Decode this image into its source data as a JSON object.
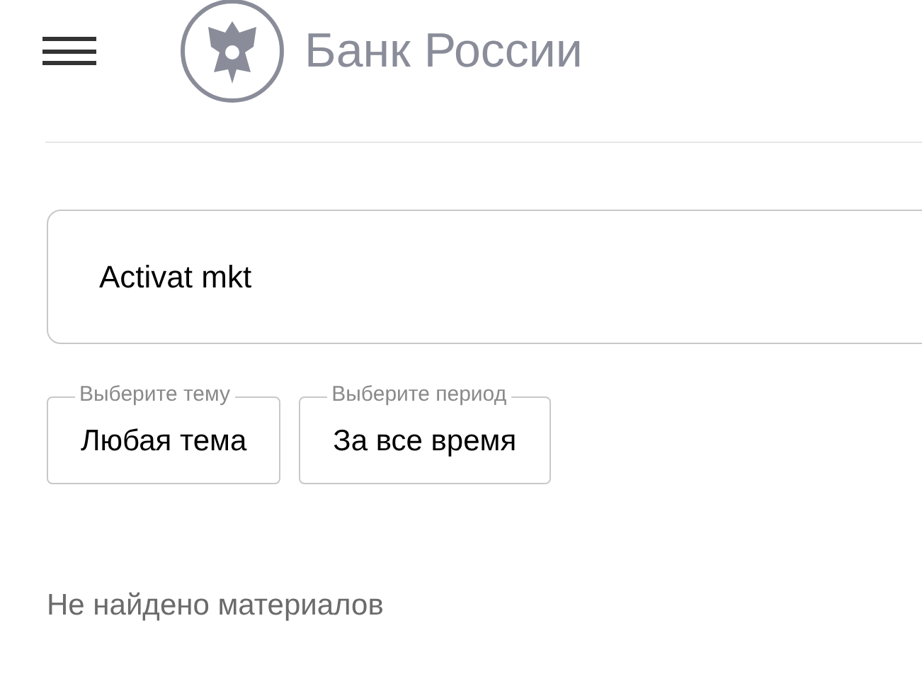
{
  "header": {
    "brand": "Банк России"
  },
  "search": {
    "value": "Activat mkt"
  },
  "filters": [
    {
      "legend": "Выберите тему",
      "value": "Любая тема"
    },
    {
      "legend": "Выберите период",
      "value": "За все время"
    }
  ],
  "message": "Не найдено материалов"
}
